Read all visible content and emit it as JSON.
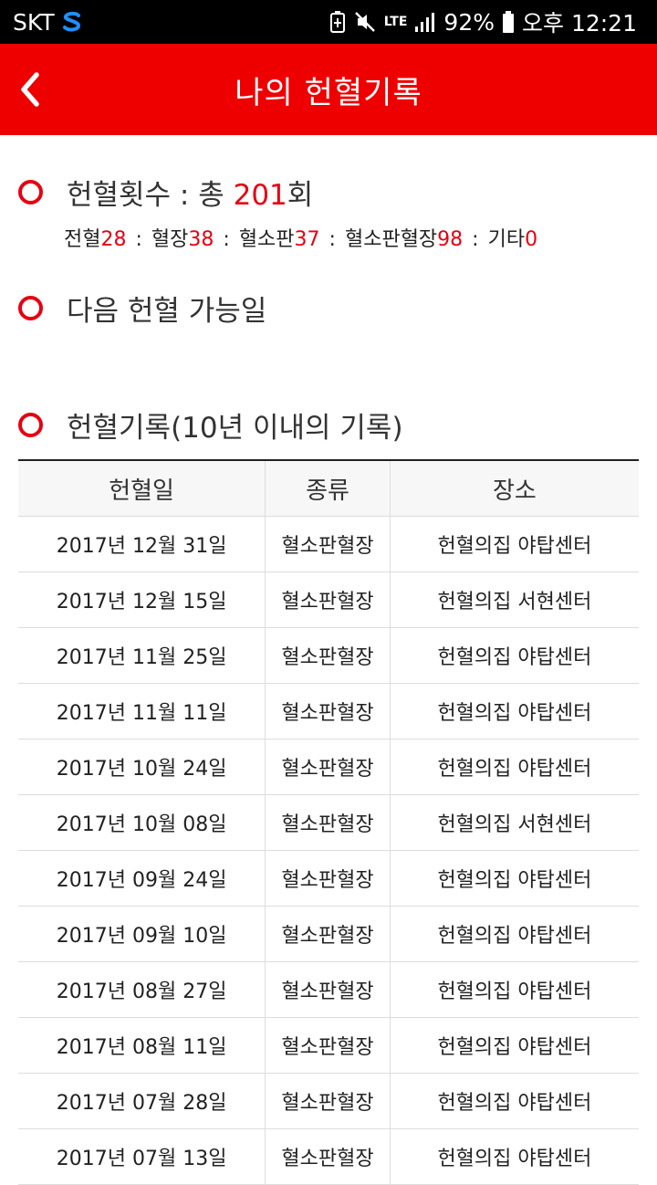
{
  "status_bar": {
    "carrier": "SKT",
    "carrier_logo_icon": "skt-logo-icon",
    "network": "LTE",
    "battery": "92%",
    "time": "오후 12:21"
  },
  "header": {
    "title": "나의 헌혈기록",
    "back_icon": "chevron-left-icon"
  },
  "count_section": {
    "label": "헌혈횟수 : 총 ",
    "total": "201",
    "suffix": "회",
    "breakdown": [
      {
        "label": "전혈",
        "value": "28"
      },
      {
        "label": "혈장",
        "value": "38"
      },
      {
        "label": "혈소판",
        "value": "37"
      },
      {
        "label": "혈소판혈장",
        "value": "98"
      },
      {
        "label": "기타",
        "value": "0"
      }
    ],
    "separator": ":"
  },
  "next_section": {
    "label": "다음 헌혈 가능일"
  },
  "record_section": {
    "label": "헌혈기록(10년 이내의 기록)"
  },
  "table": {
    "headers": [
      "헌혈일",
      "종류",
      "장소"
    ],
    "rows": [
      [
        "2017년 12월 31일",
        "혈소판혈장",
        "헌혈의집 야탑센터"
      ],
      [
        "2017년 12월 15일",
        "혈소판혈장",
        "헌혈의집 서현센터"
      ],
      [
        "2017년 11월 25일",
        "혈소판혈장",
        "헌혈의집 야탑센터"
      ],
      [
        "2017년 11월 11일",
        "혈소판혈장",
        "헌혈의집 야탑센터"
      ],
      [
        "2017년 10월 24일",
        "혈소판혈장",
        "헌혈의집 야탑센터"
      ],
      [
        "2017년 10월 08일",
        "혈소판혈장",
        "헌혈의집 서현센터"
      ],
      [
        "2017년 09월 24일",
        "혈소판혈장",
        "헌혈의집 야탑센터"
      ],
      [
        "2017년 09월 10일",
        "혈소판혈장",
        "헌혈의집 야탑센터"
      ],
      [
        "2017년 08월 27일",
        "혈소판혈장",
        "헌혈의집 야탑센터"
      ],
      [
        "2017년 08월 11일",
        "혈소판혈장",
        "헌혈의집 야탑센터"
      ],
      [
        "2017년 07월 28일",
        "혈소판혈장",
        "헌혈의집 야탑센터"
      ],
      [
        "2017년 07월 13일",
        "혈소판혈장",
        "헌혈의집 야탑센터"
      ]
    ]
  },
  "colors": {
    "accent": "#ee0000",
    "value_red": "#e60012"
  }
}
